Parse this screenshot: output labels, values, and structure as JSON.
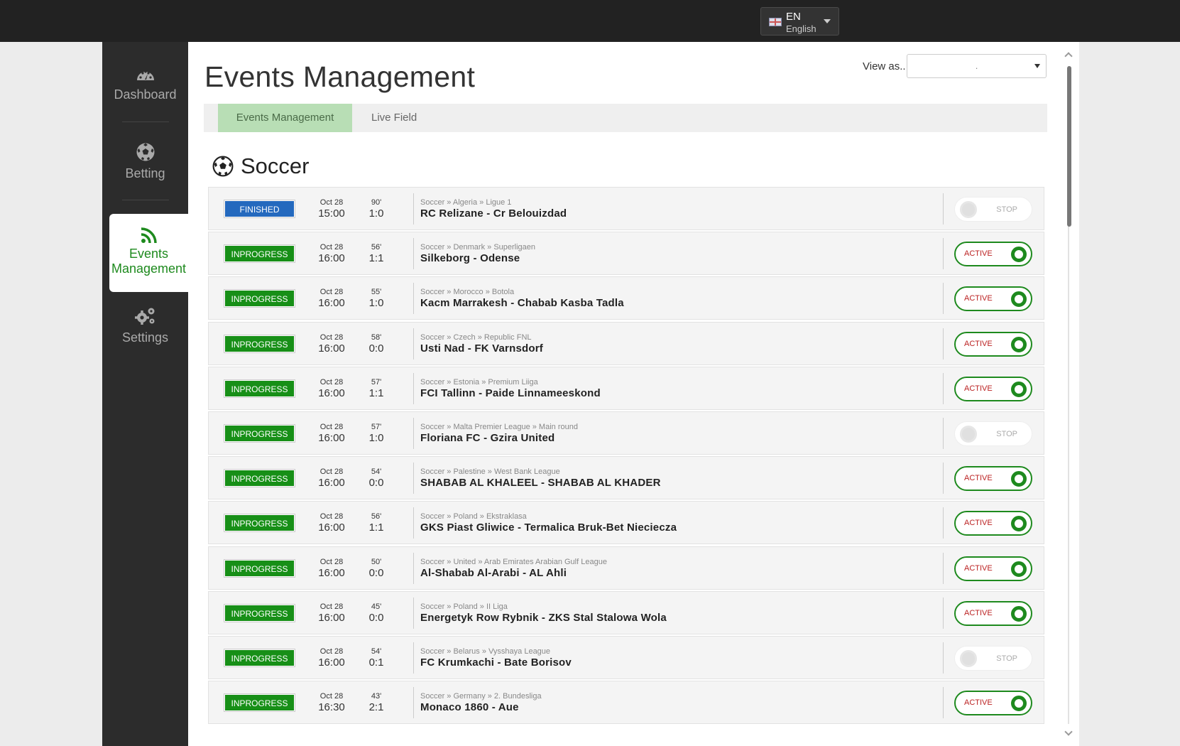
{
  "topbar": {
    "language": {
      "code": "EN",
      "name": "English",
      "icon": "uk-flag-icon"
    }
  },
  "sidebar": {
    "items": [
      {
        "label": "Dashboard",
        "icon": "dashboard-icon"
      },
      {
        "label": "Betting",
        "icon": "soccer-ball-icon"
      },
      {
        "label": "Events Management",
        "icon": "rss-feed-icon"
      },
      {
        "label": "Settings",
        "icon": "gears-icon"
      }
    ],
    "active_index": 2
  },
  "main": {
    "title": "Events Management",
    "view_as": {
      "label": "View as..",
      "value": "."
    },
    "tabs": [
      {
        "label": "Events Management",
        "active": true
      },
      {
        "label": "Live Field",
        "active": false
      }
    ],
    "sport": {
      "name": "Soccer",
      "icon": "soccer-ball-icon"
    }
  },
  "colors": {
    "inprogress": "#178f17",
    "finished": "#2469be",
    "active_toggle": "#1e8a1e",
    "active_tab_bg": "#b8deb5"
  },
  "events": [
    {
      "status": "FINISHED",
      "date": "Oct 28",
      "time": "15:00",
      "minute": "90'",
      "score": "1:0",
      "path": "Soccer » Algeria » Ligue 1",
      "match": "RC Relizane - Cr Belouizdad",
      "toggle": "STOP"
    },
    {
      "status": "INPROGRESS",
      "date": "Oct 28",
      "time": "16:00",
      "minute": "56'",
      "score": "1:1",
      "path": "Soccer » Denmark » Superligaen",
      "match": "Silkeborg - Odense",
      "toggle": "ACTIVE"
    },
    {
      "status": "INPROGRESS",
      "date": "Oct 28",
      "time": "16:00",
      "minute": "55'",
      "score": "1:0",
      "path": "Soccer » Morocco » Botola",
      "match": "Kacm Marrakesh - Chabab Kasba Tadla",
      "toggle": "ACTIVE"
    },
    {
      "status": "INPROGRESS",
      "date": "Oct 28",
      "time": "16:00",
      "minute": "58'",
      "score": "0:0",
      "path": "Soccer » Czech » Republic FNL",
      "match": "Usti Nad - FK Varnsdorf",
      "toggle": "ACTIVE"
    },
    {
      "status": "INPROGRESS",
      "date": "Oct 28",
      "time": "16:00",
      "minute": "57'",
      "score": "1:1",
      "path": "Soccer » Estonia » Premium Liiga",
      "match": "FCI Tallinn - Paide Linnameeskond",
      "toggle": "ACTIVE"
    },
    {
      "status": "INPROGRESS",
      "date": "Oct 28",
      "time": "16:00",
      "minute": "57'",
      "score": "1:0",
      "path": "Soccer » Malta Premier League » Main round",
      "match": "Floriana FC - Gzira United",
      "toggle": "STOP"
    },
    {
      "status": "INPROGRESS",
      "date": "Oct 28",
      "time": "16:00",
      "minute": "54'",
      "score": "0:0",
      "path": "Soccer » Palestine » West Bank League",
      "match": "SHABAB AL KHALEEL - SHABAB AL KHADER",
      "toggle": "ACTIVE"
    },
    {
      "status": "INPROGRESS",
      "date": "Oct 28",
      "time": "16:00",
      "minute": "56'",
      "score": "1:1",
      "path": "Soccer » Poland » Ekstraklasa",
      "match": "GKS Piast Gliwice - Termalica Bruk-Bet Nieciecza",
      "toggle": "ACTIVE"
    },
    {
      "status": "INPROGRESS",
      "date": "Oct 28",
      "time": "16:00",
      "minute": "50'",
      "score": "0:0",
      "path": "Soccer » United » Arab Emirates Arabian Gulf League",
      "match": "Al-Shabab Al-Arabi - AL Ahli",
      "toggle": "ACTIVE"
    },
    {
      "status": "INPROGRESS",
      "date": "Oct 28",
      "time": "16:00",
      "minute": "45'",
      "score": "0:0",
      "path": "Soccer » Poland » II Liga",
      "match": "Energetyk Row Rybnik - ZKS Stal Stalowa Wola",
      "toggle": "ACTIVE"
    },
    {
      "status": "INPROGRESS",
      "date": "Oct 28",
      "time": "16:00",
      "minute": "54'",
      "score": "0:1",
      "path": "Soccer » Belarus » Vysshaya League",
      "match": "FC Krumkachi - Bate Borisov",
      "toggle": "STOP"
    },
    {
      "status": "INPROGRESS",
      "date": "Oct 28",
      "time": "16:30",
      "minute": "43'",
      "score": "2:1",
      "path": "Soccer » Germany » 2. Bundesliga",
      "match": "Monaco 1860 - Aue",
      "toggle": "ACTIVE"
    }
  ]
}
